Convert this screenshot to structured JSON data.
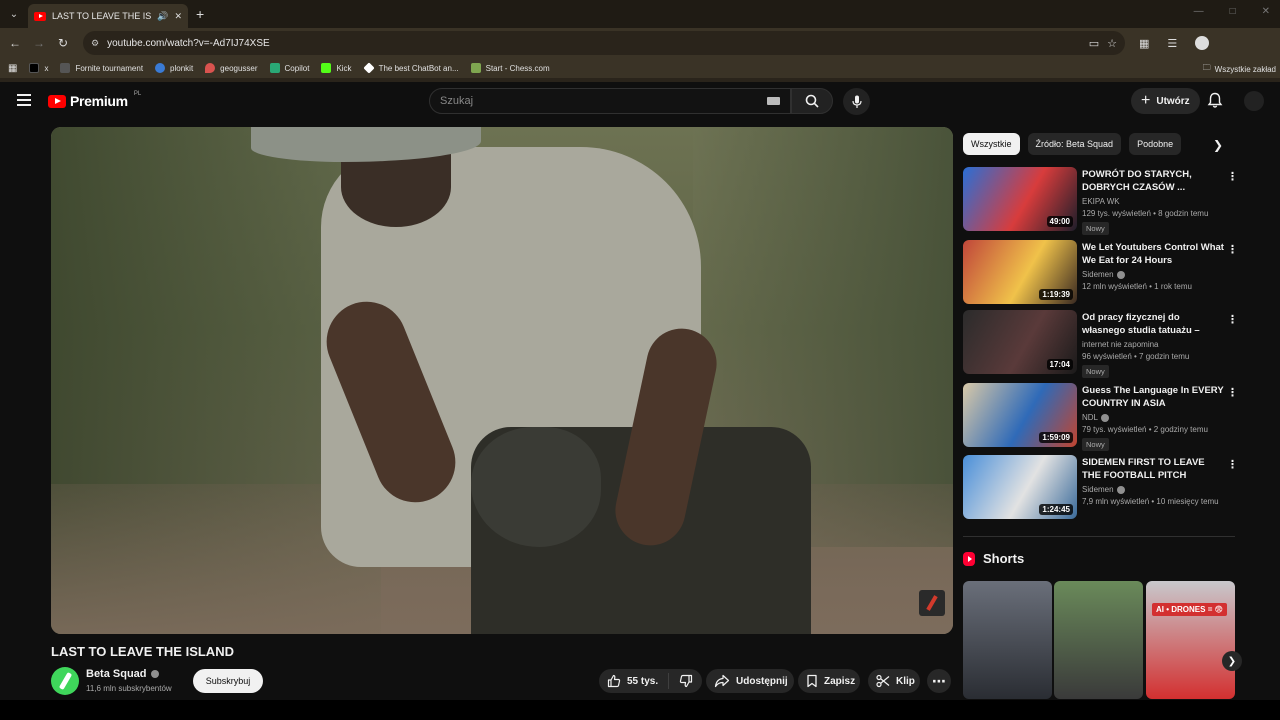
{
  "browser": {
    "tab_title": "LAST TO LEAVE THE ISLAND",
    "url": "youtube.com/watch?v=-Ad7IJ74XSE",
    "bookmarks": [
      {
        "label": "x",
        "color": "#000000"
      },
      {
        "label": "Fornite tournament",
        "color": "#555555"
      },
      {
        "label": "plonkit",
        "color": "#3a7bd5"
      },
      {
        "label": "geogusser",
        "color": "#d9534f"
      },
      {
        "label": "Copilot",
        "color": "#2aa876"
      },
      {
        "label": "Kick",
        "color": "#53fc18"
      },
      {
        "label": "The best ChatBot an...",
        "color": "#ffffff"
      },
      {
        "label": "Start - Chess.com",
        "color": "#7fa650"
      }
    ],
    "bookmarks_right": "Wszystkie zakład"
  },
  "header": {
    "logo_text": "Premium",
    "logo_region": "PL",
    "search_placeholder": "Szukaj",
    "create_label": "Utwórz"
  },
  "video": {
    "title": "LAST TO LEAVE THE ISLAND",
    "channel": "Beta Squad",
    "subscribers": "11,6 mln subskrybentów",
    "subscribe_label": "Subskrybuj",
    "likes": "55 tys.",
    "share_label": "Udostępnij",
    "save_label": "Zapisz",
    "clip_label": "Klip"
  },
  "filters": [
    {
      "label": "Wszystkie",
      "active": true
    },
    {
      "label": "Źródło: Beta Squad",
      "active": false
    },
    {
      "label": "Podobne",
      "active": false
    }
  ],
  "recommendations": [
    {
      "title": "POWRÓT DO STARYCH, DOBRYCH CZASÓW ...",
      "channel": "EKIPA WK",
      "verified": false,
      "meta": "129 tys. wyświetleń • 8 godzin temu",
      "badge": "Nowy",
      "duration": "49:00",
      "thumb_colors": [
        "#2a6fd6",
        "#d83c3c",
        "#1e1e2a"
      ]
    },
    {
      "title": "We Let Youtubers Control What We Eat for 24 Hours",
      "channel": "Sidemen",
      "verified": true,
      "meta": "12 mln wyświetleń • 1 rok temu",
      "badge": "",
      "duration": "1:19:39",
      "thumb_colors": [
        "#c0463a",
        "#f0c24a",
        "#3a2a22"
      ]
    },
    {
      "title": "Od pracy fizycznej do własnego studia tatuażu – historia Lord ...",
      "channel": "internet nie zapomina",
      "verified": false,
      "meta": "96 wyświetleń • 7 godzin temu",
      "badge": "Nowy",
      "duration": "17:04",
      "thumb_colors": [
        "#2b2b2b",
        "#5a3a3a",
        "#1a1a1a"
      ]
    },
    {
      "title": "Guess The Language In EVERY COUNTRY IN ASIA",
      "channel": "NDL",
      "verified": true,
      "meta": "79 tys. wyświetleń • 2 godziny temu",
      "badge": "Nowy",
      "duration": "1:59:09",
      "thumb_colors": [
        "#d9c9a8",
        "#2f6ab8",
        "#c2442f"
      ]
    },
    {
      "title": "SIDEMEN FIRST TO LEAVE THE FOOTBALL PITCH",
      "channel": "Sidemen",
      "verified": true,
      "meta": "7,9 mln wyświetleń • 10 miesięcy temu",
      "badge": "",
      "duration": "1:24:45",
      "thumb_colors": [
        "#4a8fd9",
        "#e2e2e2",
        "#3a6a9a"
      ]
    }
  ],
  "shorts": {
    "heading": "Shorts",
    "items": [
      {
        "thumb_colors": [
          "#6a6f7a",
          "#2a2d33"
        ]
      },
      {
        "thumb_colors": [
          "#6a8a5a",
          "#3a3a3a"
        ]
      },
      {
        "thumb_colors": [
          "#c8c8cc",
          "#d33030"
        ],
        "overlay": "AI • DRONES = 😨"
      }
    ]
  }
}
